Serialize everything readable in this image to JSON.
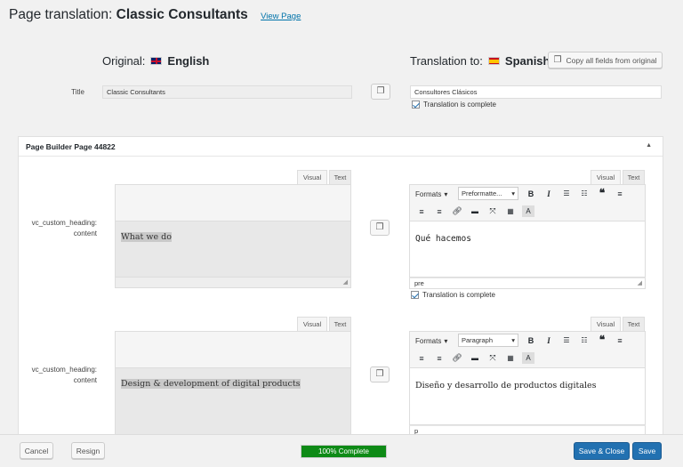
{
  "header": {
    "prefix": "Page translation: ",
    "title": "Classic Consultants",
    "view_page": "View Page"
  },
  "original": {
    "label": "Original:",
    "language": "English",
    "flag": "uk-flag-icon"
  },
  "translation": {
    "label": "Translation to:",
    "language": "Spanish",
    "flag": "spain-flag-icon"
  },
  "copy_all_label": "Copy all fields from original",
  "title_field": {
    "label": "Title",
    "original_value": "Classic Consultants",
    "translated_value": "Consultores Clásicos",
    "complete_label": "Translation is complete"
  },
  "panel": {
    "title": "Page Builder Page 44822",
    "fields": [
      {
        "label_line1": "vc_custom_heading:",
        "label_line2": "content",
        "original_text": "What we do",
        "translated_text": "Qué hacemos",
        "format": "Preformatte...",
        "footer_tag": "pre",
        "complete_label": "Translation is complete"
      },
      {
        "label_line1": "vc_custom_heading:",
        "label_line2": "content",
        "original_text": "Design & development of digital products",
        "translated_text": "Diseño y desarrollo de productos digitales",
        "format": "Paragraph",
        "footer_tag": "p"
      }
    ]
  },
  "editor": {
    "visual_tab": "Visual",
    "text_tab": "Text",
    "formats_label": "Formats"
  },
  "footer": {
    "cancel": "Cancel",
    "resign": "Resign",
    "progress_text": "100% Complete",
    "progress_fraction": 1.0,
    "save_close": "Save & Close",
    "save": "Save"
  },
  "colors": {
    "accent": "#2271b1",
    "progress": "#0e8a16"
  }
}
